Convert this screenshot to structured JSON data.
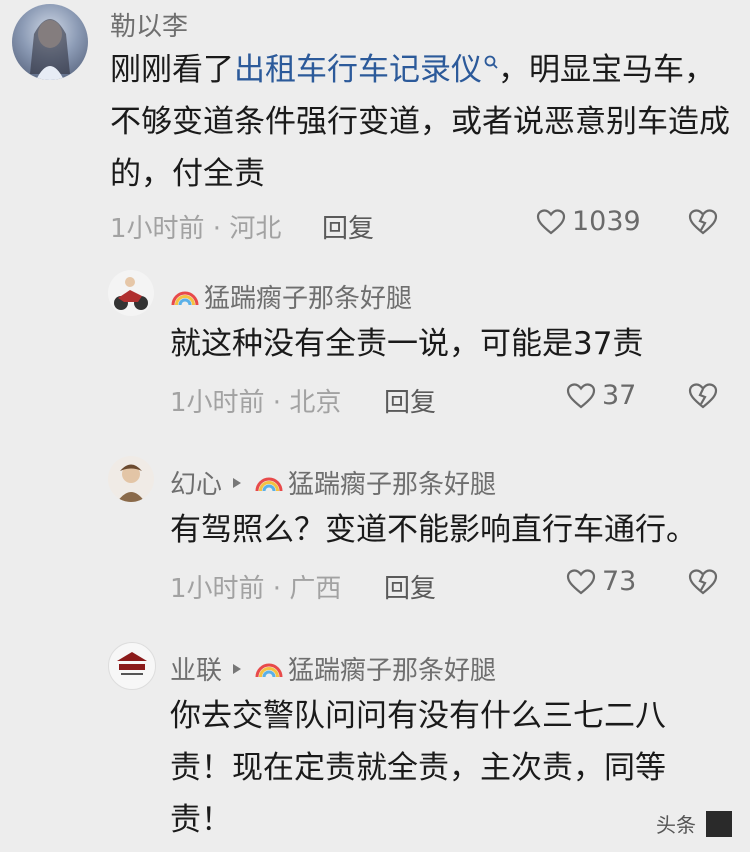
{
  "comments": [
    {
      "author": "勒以李",
      "text_before": "刚刚看了",
      "link_text": "出租车行车记录仪",
      "text_after": "，明显宝马车，不够变道条件强行变道，或者说恶意别车造成的，付全责",
      "time": "1小时前",
      "location": "河北",
      "reply_label": "回复",
      "likes": "1039"
    },
    {
      "author": "猛踹瘸子那条好腿",
      "text": "就这种没有全责一说，可能是37责",
      "time": "1小时前",
      "location": "北京",
      "reply_label": "回复",
      "likes": "37"
    },
    {
      "author": "幻心",
      "reply_to": "猛踹瘸子那条好腿",
      "text": "有驾照么？变道不能影响直行车通行。",
      "time": "1小时前",
      "location": "广西",
      "reply_label": "回复",
      "likes": "73"
    },
    {
      "author": "业联",
      "reply_to": "猛踹瘸子那条好腿",
      "text": "你去交警队问问有没有什么三七二八责！现在定责就全责，主次责，同等责！"
    }
  ],
  "watermark": "头条",
  "icons": {
    "search": "search-icon",
    "heart": "heart-icon",
    "broken_heart": "broken-heart-icon",
    "rainbow": "rainbow-badge-icon",
    "reply_arrow": "reply-arrow-icon"
  }
}
